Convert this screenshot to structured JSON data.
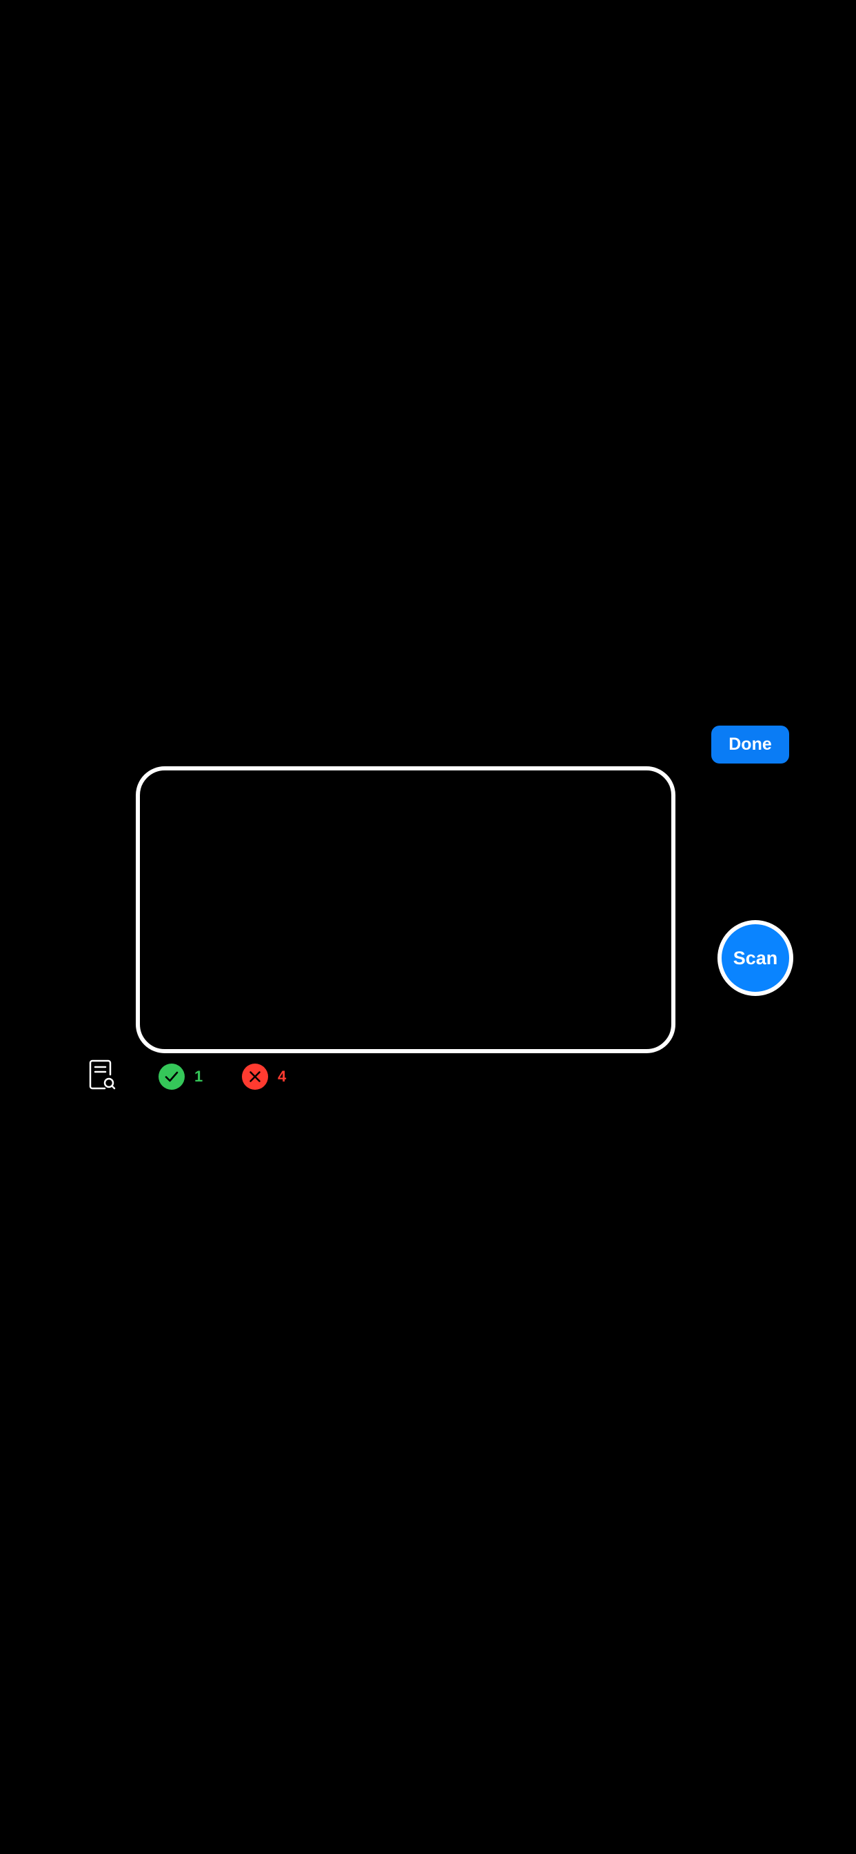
{
  "scanner": {
    "done_label": "Done",
    "scan_label": "Scan",
    "frame_icon": "document-search-icon",
    "results": {
      "success_icon": "checkmark-circle-icon",
      "success_count": "1",
      "failure_icon": "x-circle-icon",
      "failure_count": "4"
    }
  },
  "colors": {
    "background": "#000000",
    "accent": "#0a84ff",
    "success": "#35c759",
    "failure": "#ff3b30",
    "frame": "#ffffff"
  }
}
